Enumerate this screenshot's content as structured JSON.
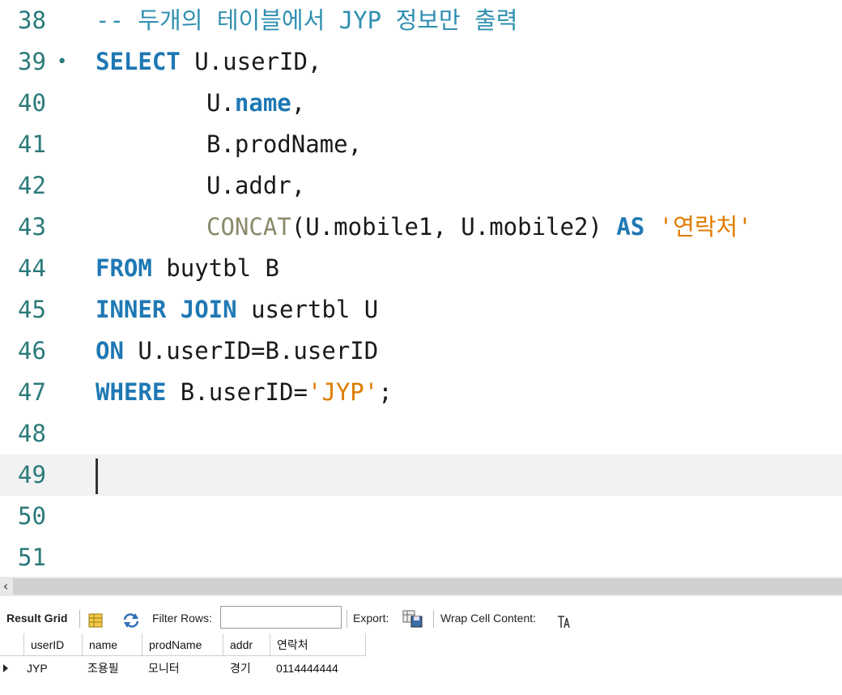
{
  "editor": {
    "lines": [
      {
        "num": "38",
        "comment": "-- 두개의 테이블에서 JYP 정보만 출력"
      },
      {
        "num": "39",
        "fold": "•",
        "kw": "SELECT",
        "text": " U.userID,"
      },
      {
        "num": "40",
        "pre": "U.",
        "kw": "name",
        "post": ","
      },
      {
        "num": "41",
        "text": "B.prodName,"
      },
      {
        "num": "42",
        "text": "U.addr,"
      },
      {
        "num": "43",
        "fn": "CONCAT",
        "text": "(U.mobile1, U.mobile2) ",
        "kw": "AS",
        "str": "'연락처'"
      },
      {
        "num": "44",
        "kw": "FROM",
        "text": " buytbl B"
      },
      {
        "num": "45",
        "kw": "INNER JOIN",
        "text": " usertbl U"
      },
      {
        "num": "46",
        "kw": "ON",
        "text": " U.userID=B.userID"
      },
      {
        "num": "47",
        "kw": "WHERE",
        "text": " B.userID=",
        "str": "'JYP'",
        "post": ";"
      },
      {
        "num": "48"
      },
      {
        "num": "49"
      },
      {
        "num": "50"
      },
      {
        "num": "51"
      }
    ]
  },
  "toolbar": {
    "result_grid": "Result Grid",
    "filter_rows": "Filter Rows:",
    "filter_value": "",
    "export": "Export:",
    "wrap": "Wrap Cell Content:"
  },
  "grid": {
    "columns": [
      "userID",
      "name",
      "prodName",
      "addr",
      "연락처"
    ],
    "rows": [
      [
        "JYP",
        "조용필",
        "모니터",
        "경기",
        "0114444444"
      ]
    ]
  },
  "icons": {
    "grid": "grid-icon",
    "refresh": "refresh-icon",
    "export": "export-icon",
    "wrap": "wrap-icon",
    "row_pointer": "row-pointer-icon",
    "scroll_left": "scroll-left-arrow"
  }
}
